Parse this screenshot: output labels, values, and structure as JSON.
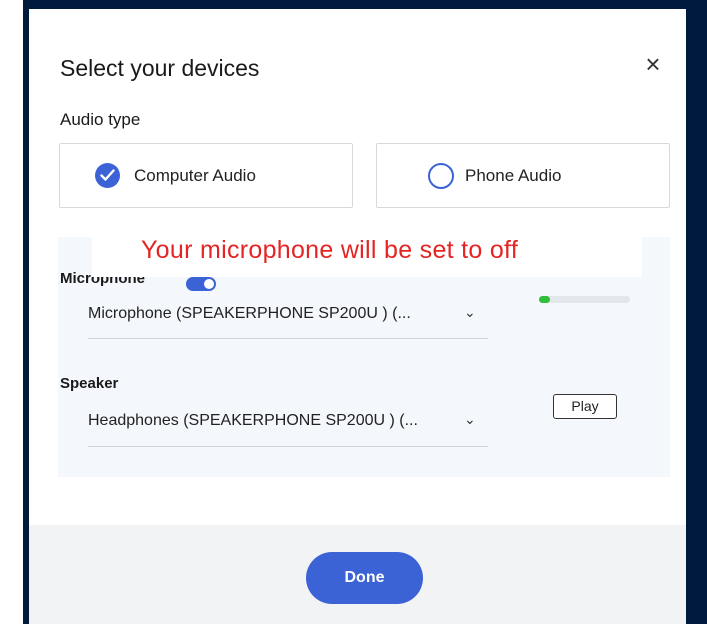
{
  "dialog": {
    "title": "Select your devices",
    "close_icon": "close-icon",
    "audio_type_label": "Audio type",
    "options": [
      {
        "label": "Computer Audio",
        "selected": true
      },
      {
        "label": "Phone Audio",
        "selected": false
      }
    ],
    "banner_message": "Your microphone will be set to off",
    "microphone": {
      "label": "Microphone",
      "enabled": true,
      "selected_device": "Microphone (SPEAKERPHONE SP200U ) (...",
      "input_level": 0.12
    },
    "speaker": {
      "label": "Speaker",
      "selected_device": "Headphones (SPEAKERPHONE SP200U ) (...",
      "play_label": "Play"
    },
    "done_label": "Done"
  },
  "colors": {
    "accent": "#3c63d6",
    "warning_text": "#e52424",
    "level_fill": "#2fbf3a",
    "frame": "#001a3d",
    "panel_bg": "#f4f7fb",
    "footer_bg": "#f2f3f5"
  }
}
